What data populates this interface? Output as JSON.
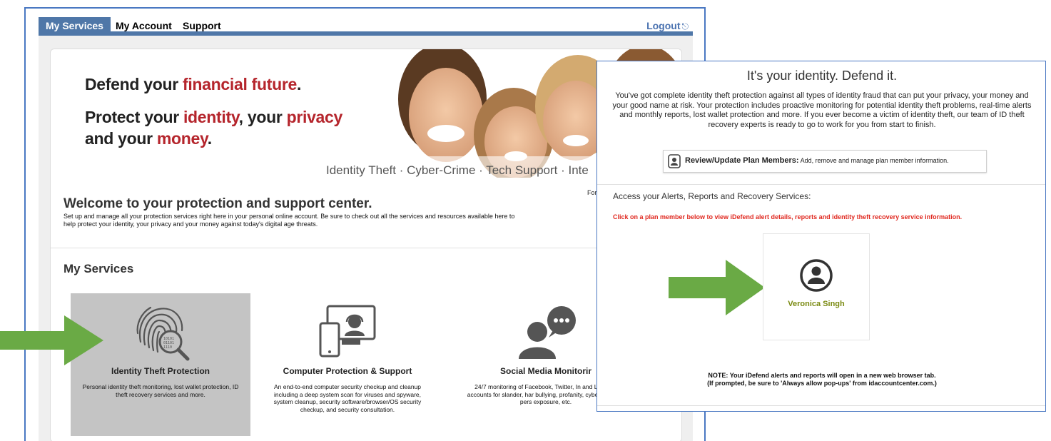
{
  "nav": {
    "tabs": [
      {
        "label": "My Services",
        "active": true
      },
      {
        "label": "My Account",
        "active": false
      },
      {
        "label": "Support",
        "active": false
      }
    ],
    "logout_label": "Logout",
    "logout_icon": "logout-icon"
  },
  "hero": {
    "line1_prefix": "Defend your ",
    "line1_emph": "financial future",
    "line1_suffix": ".",
    "line2_prefix": "Protect your ",
    "line2_emph1": "identity",
    "line2_mid1": ", your ",
    "line2_emph2": "privacy",
    "line2_mid2": " and your ",
    "line2_emph3": "money",
    "line2_suffix": ".",
    "tagline": "Identity Theft · Cyber-Crime · Tech Support · Inte"
  },
  "welcome": {
    "title": "Welcome to your protection and support center.",
    "text": "Set up and manage all your protection services right here in your personal online account. Be sure to check out all the services and resources available here to help protect your identity, your privacy and your money against today's digital age threats.",
    "for_text": "For"
  },
  "services": {
    "heading": "My Services",
    "items": [
      {
        "title": "Identity Theft Protection",
        "desc": "Personal identity theft monitoring, lost wallet protection, ID theft recovery services and more.",
        "icon": "fingerprint-search-icon"
      },
      {
        "title": "Computer Protection & Support",
        "desc": "An end-to-end computer security checkup and cleanup including a deep system scan for viruses and spyware, system cleanup, security software/browser/OS security checkup, and security consultation.",
        "icon": "devices-support-icon"
      },
      {
        "title": "Social Media Monitorir",
        "desc": "24/7 monitoring of Facebook, Twitter, In and LinkedIn accounts for slander, har bullying, profanity, cyber-stalking, pers exposure, etc.",
        "icon": "person-chat-icon"
      }
    ]
  },
  "overlay": {
    "title": "It's your identity. Defend it.",
    "desc": "You've got complete identity theft protection against all types of identity fraud that can put your privacy, your money and your good name at risk. Your protection includes proactive monitoring for potential identity theft problems, real-time alerts and monthly reports, lost wallet protection and more. If you ever become a victim of identity theft, our team of ID theft recovery experts is ready to go to work for you from start to finish.",
    "review_label": "Review/Update Plan Members:",
    "review_text": " Add, remove and manage plan member information.",
    "access_title": "Access your Alerts, Reports and Recovery Services:",
    "click_text": "Click on a plan member below to view iDefend alert details, reports and identity theft recovery service information.",
    "member_name": "Veronica Singh",
    "note_line1": "NOTE: Your iDefend alerts and reports will open in a new web browser tab.",
    "note_line2": "(If prompted, be sure to 'Always allow pop-ups' from idaccountcenter.com.)"
  },
  "colors": {
    "tab_active": "#4f77a8",
    "accent_red": "#b5252c",
    "alert_red": "#e0281f",
    "arrow_green": "#6aaa45",
    "member_green": "#7a8a12",
    "frame_blue": "#4a78c2"
  }
}
